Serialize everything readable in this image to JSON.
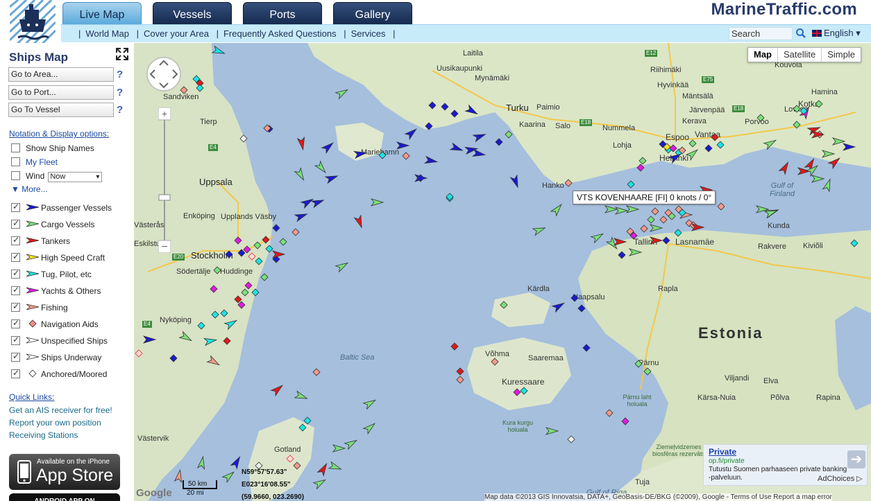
{
  "brand": "MarineTraffic.com",
  "tabs": [
    {
      "label": "Live Map",
      "active": true
    },
    {
      "label": "Vessels",
      "active": false
    },
    {
      "label": "Ports",
      "active": false
    },
    {
      "label": "Gallery",
      "active": false
    }
  ],
  "subnav": {
    "links": [
      "World Map",
      "Cover your Area",
      "Frequently Asked Questions",
      "Services"
    ],
    "search_placeholder": "Search",
    "language": "English"
  },
  "sidebar": {
    "title": "Ships Map",
    "goto": [
      {
        "label": "Go to Area...",
        "help": "?"
      },
      {
        "label": "Go to Port...",
        "help": "?"
      },
      {
        "label": "Go To Vessel",
        "help": "?"
      }
    ],
    "notation_title": "Notation & Display options:",
    "options": {
      "show_names": "Show Ship Names",
      "my_fleet": "My Fleet",
      "wind": "Wind",
      "wind_value": "Now"
    },
    "more": "More...",
    "legend": [
      {
        "label": "Passenger Vessels",
        "color": "#1a1ad0",
        "checked": true,
        "icon": "ship-arrow"
      },
      {
        "label": "Cargo Vessels",
        "color": "#7ae07a",
        "checked": true,
        "icon": "ship-arrow"
      },
      {
        "label": "Tankers",
        "color": "#e01a1a",
        "checked": true,
        "icon": "ship-arrow"
      },
      {
        "label": "High Speed Craft",
        "color": "#f5e51a",
        "checked": true,
        "icon": "ship-arrow"
      },
      {
        "label": "Tug, Pilot, etc",
        "color": "#1ae5e5",
        "checked": true,
        "icon": "ship-arrow"
      },
      {
        "label": "Yachts & Others",
        "color": "#e01ae0",
        "checked": true,
        "icon": "ship-arrow"
      },
      {
        "label": "Fishing",
        "color": "#f59a8a",
        "checked": true,
        "icon": "ship-arrow"
      },
      {
        "label": "Navigation Aids",
        "color": "#ff8a8a",
        "checked": true,
        "icon": "diamond"
      },
      {
        "label": "Unspecified Ships",
        "color": "#ffffff",
        "checked": true,
        "icon": "ship-arrow"
      },
      {
        "label": "Ships Underway",
        "color": "#ffffff",
        "checked": true,
        "icon": "ship-arrow"
      },
      {
        "label": "Anchored/Moored",
        "color": "#ffffff",
        "checked": true,
        "icon": "diamond"
      }
    ],
    "quick_links_title": "Quick Links:",
    "quick_links": [
      "Get an AIS receiver for free!",
      "Report your own position",
      "Receiving Stations"
    ],
    "appstore_small": "Available on the iPhone",
    "appstore_big": "App Store",
    "android": "ANDROID APP ON"
  },
  "map": {
    "map_types": [
      "Map",
      "Satellite",
      "Simple"
    ],
    "selected_map_type": "Map",
    "tooltip": "VTS KOVENHAARE [FI] 0 knots / 0°",
    "labels": {
      "cities": [
        "Turku",
        "Espoo",
        "Vantaa",
        "Helsinki",
        "Tallinn",
        "Lasnamäe",
        "Stockholm",
        "Uppsala",
        "Mariehamn",
        "Hanko",
        "Kotka",
        "Hamina",
        "Porvoo",
        "Lohja",
        "Salo",
        "Paimio",
        "Kaarina",
        "Laitila",
        "Uusikaupunki",
        "Mynämäki",
        "Sandviken",
        "Tierp",
        "Enköping",
        "Upplands Väsby",
        "Södertälje",
        "Huddinge",
        "Nyköping",
        "Västerås",
        "Eskilstuna",
        "Västervik",
        "Rakvere",
        "Kiviõli",
        "Kunda",
        "Kärdla",
        "Haapsalu",
        "Rapla",
        "Pärnu",
        "Viljandi",
        "Elva",
        "Kärsa-Nuia",
        "Põlva",
        "Rapina",
        "Kuressaare",
        "Võhma",
        "Saaremaa",
        "Gotland",
        "Riihimäki",
        "Hyvinkää",
        "Järvenpää",
        "Kerava",
        "Mäntsälä",
        "Kouvola",
        "Nummela",
        "Loviisa",
        "Tuja"
      ],
      "seas": [
        "Baltic Sea",
        "Gulf of Finland",
        "Gulf of Riga"
      ],
      "country": "Estonia",
      "parks": [
        "Pärnu laht hoiuala",
        "Kura kurgu hoiuala",
        "Ziemeļvidzemes biosfēras rezervāts"
      ],
      "roads": [
        "E12",
        "E75",
        "E18",
        "E18",
        "E4",
        "E20",
        "E4"
      ]
    },
    "coordinates": [
      "N59°57'57.63\"",
      "E023°16'08.55\"",
      "(59.9660, 023.2690)"
    ],
    "scale": [
      "50 km",
      "20 mi"
    ],
    "attribution": "Map data ©2013 GIS Innovatsia, DATA+, GeoBasis-DE/BKG (©2009), Google - Terms of Use  Report a map error",
    "google": "Google"
  },
  "ad": {
    "title": "Private",
    "url": "op.fi/private",
    "desc": "Tutustu Suomen parhaaseen private banking -palveluun.",
    "adchoices": "AdChoices"
  }
}
